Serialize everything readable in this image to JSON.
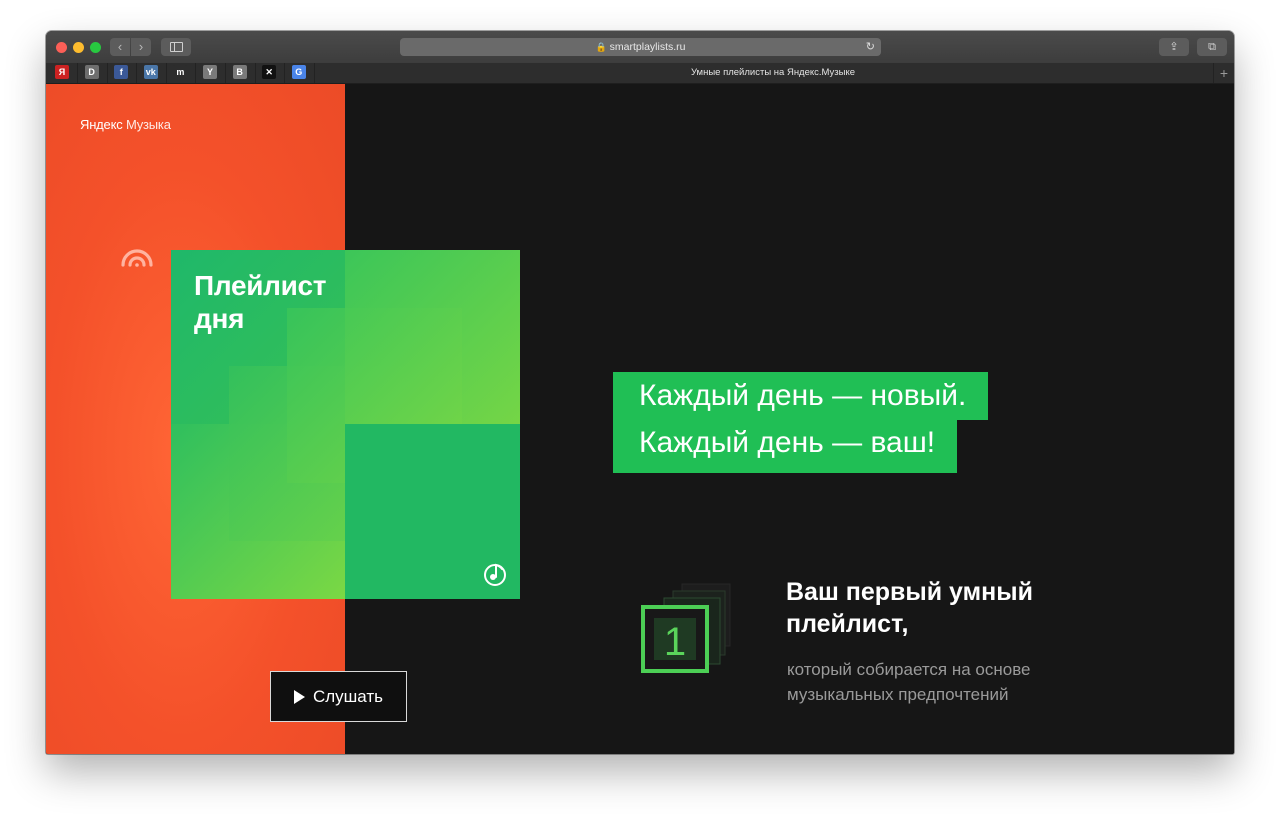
{
  "browser": {
    "url": "smartplaylists.ru",
    "tab_title": "Умные плейлисты на Яндекс.Музыке",
    "new_tab_label": "+",
    "favorites": [
      {
        "icon": "yandex-favicon",
        "glyph": "Я",
        "color": "#cc2222"
      },
      {
        "icon": "d-favicon",
        "glyph": "D",
        "color": "#6e6e6e"
      },
      {
        "icon": "facebook-favicon",
        "glyph": "f",
        "color": "#3b5998"
      },
      {
        "icon": "vk-favicon",
        "glyph": "vk",
        "color": "#4a76a8"
      },
      {
        "icon": "m-favicon",
        "glyph": "m",
        "color": "#2d2d2d"
      },
      {
        "icon": "y-favicon",
        "glyph": "Y",
        "color": "#7a7a7a"
      },
      {
        "icon": "b-favicon",
        "glyph": "B",
        "color": "#7a7a7a"
      },
      {
        "icon": "pattern-favicon",
        "glyph": "✕",
        "color": "#111111"
      },
      {
        "icon": "translate-favicon",
        "glyph": "G",
        "color": "#4a84e8"
      }
    ]
  },
  "page": {
    "logo": {
      "part1": "Яндекс",
      "part2": "Музыка"
    },
    "cover": {
      "title": "Плейлист\nдня"
    },
    "listen_button": "Слушать",
    "tagline": {
      "line1": "Каждый день — новый.",
      "line2": "Каждый день — ваш!"
    },
    "feature": {
      "number": "1",
      "title": "Ваш первый умный\nплейлист,",
      "description": "который собирается на основе\nмузыкальных предпочтений"
    }
  },
  "colors": {
    "orange": "#f4512a",
    "green": "#20bf55",
    "background": "#161616"
  }
}
